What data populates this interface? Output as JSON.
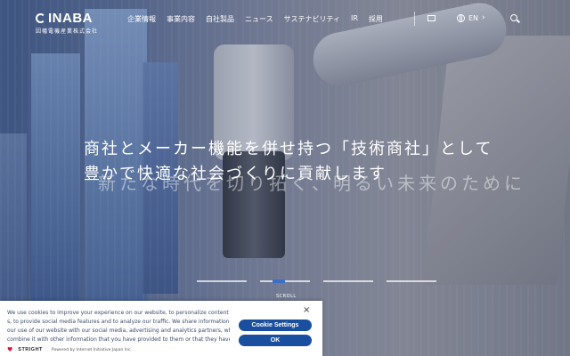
{
  "logo": {
    "name": "INABA",
    "subtitle": "因幡電機産業株式会社"
  },
  "nav": {
    "items": [
      "企業情報",
      "事業内容",
      "自社製品",
      "ニュース",
      "サステナビリティ",
      "IR",
      "採用"
    ],
    "language": "EN"
  },
  "hero": {
    "headline_line1": "商社とメーカー機能を併せ持つ「技術商社」として",
    "headline_line2": "豊かで快適な社会づくりに貢献します",
    "ghost_text": "新たな時代を切り拓く、明るい未来のために",
    "scroll_label": "SCROLL",
    "slide_count": 4,
    "active_slide": 2
  },
  "cookie": {
    "lines": [
      "We use cookies to improve your experience on our website, to personalize content and ad",
      "s, to provide social media features and to analyze our traffic. We share information about y",
      "our use of our website with our social media, advertising and analytics partners, who may",
      "combine it with other information that you have provided to them or that they have collec"
    ],
    "settings_label": "Cookie Settings",
    "ok_label": "OK",
    "close_label": "×",
    "brand": "STRIGHT",
    "powered_by": "Powered by Internet Initiative Japan Inc."
  },
  "colors": {
    "accent": "#1a4fa0",
    "indicator_active": "#3b6fc4",
    "brand_heart": "#d0113c"
  }
}
